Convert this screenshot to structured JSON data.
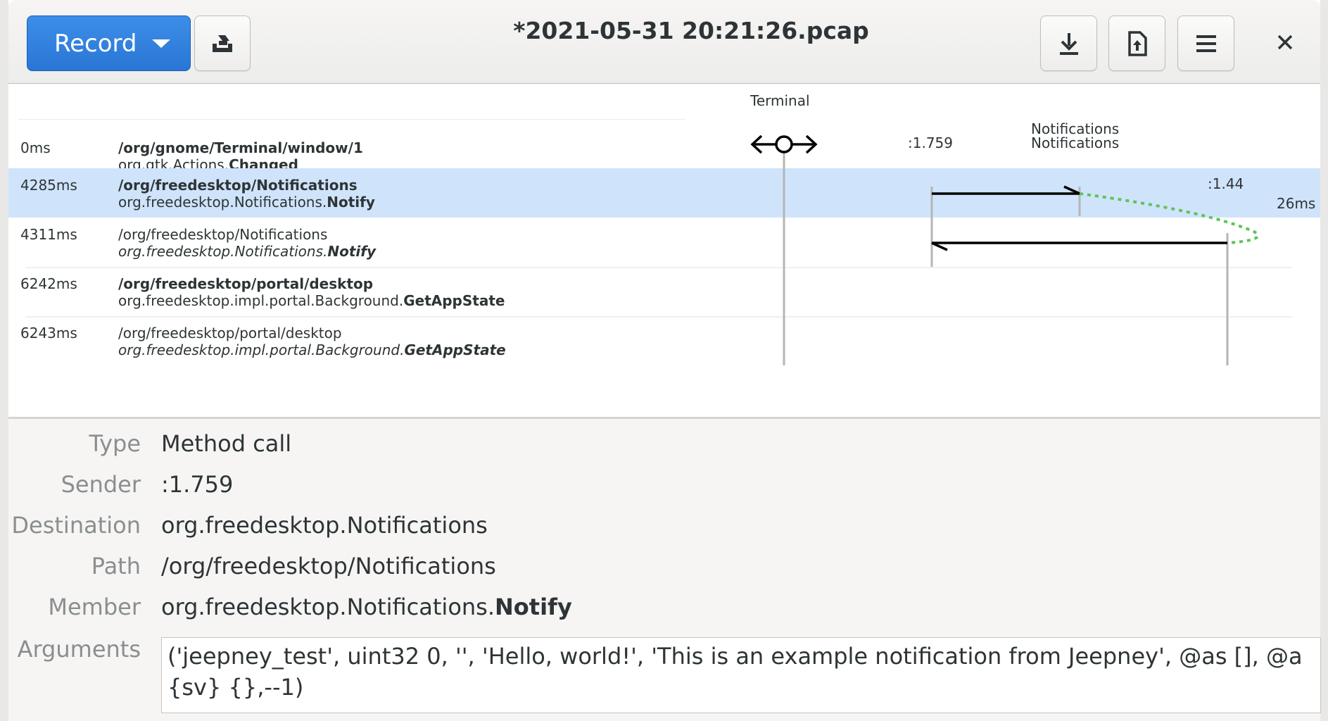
{
  "header": {
    "record_label": "Record",
    "title": "*2021-05-31 20:21:26.pcap",
    "buttons": [
      "clear-icon",
      "save-icon",
      "open-icon",
      "menu-icon",
      "close-icon"
    ]
  },
  "timeline": {
    "participants": {
      "terminal": "Terminal",
      "notifications_1": "Notifications",
      "notifications_2": "Notifications",
      "sender": ":1.759",
      "receiver": ":1.44",
      "latency": "26ms"
    },
    "rows": [
      {
        "time": "0ms",
        "path": "/org/gnome/Terminal/window/1",
        "iface": "org.gtk.Actions.",
        "member": "Changed"
      },
      {
        "time": "4285ms",
        "path": "/org/freedesktop/Notifications",
        "iface": "org.freedesktop.Notifications.",
        "member": "Notify"
      },
      {
        "time": "4311ms",
        "path": "/org/freedesktop/Notifications",
        "iface": "org.freedesktop.Notifications.",
        "member": "Notify"
      },
      {
        "time": "6242ms",
        "path": "/org/freedesktop/portal/desktop",
        "iface": "org.freedesktop.impl.portal.Background.",
        "member": "GetAppState"
      },
      {
        "time": "6243ms",
        "path": "/org/freedesktop/portal/desktop",
        "iface": "org.freedesktop.impl.portal.Background.",
        "member": "GetAppState"
      }
    ]
  },
  "details": {
    "labels": {
      "type": "Type",
      "sender": "Sender",
      "destination": "Destination",
      "path": "Path",
      "member": "Member",
      "arguments": "Arguments"
    },
    "type": "Method call",
    "sender": ":1.759",
    "destination": "org.freedesktop.Notifications",
    "path": "/org/freedesktop/Notifications",
    "member_iface": "org.freedesktop.Notifications.",
    "member_name": "Notify",
    "arguments": "('jeepney_test', uint32 0, '', 'Hello, world!', 'This is an example notification from Jeepney', @as [], @a{sv} {},--1)"
  },
  "colors": {
    "accent": "#3584e4",
    "selection": "#cfe4fb",
    "reply_dotted": "#5ec35a"
  }
}
